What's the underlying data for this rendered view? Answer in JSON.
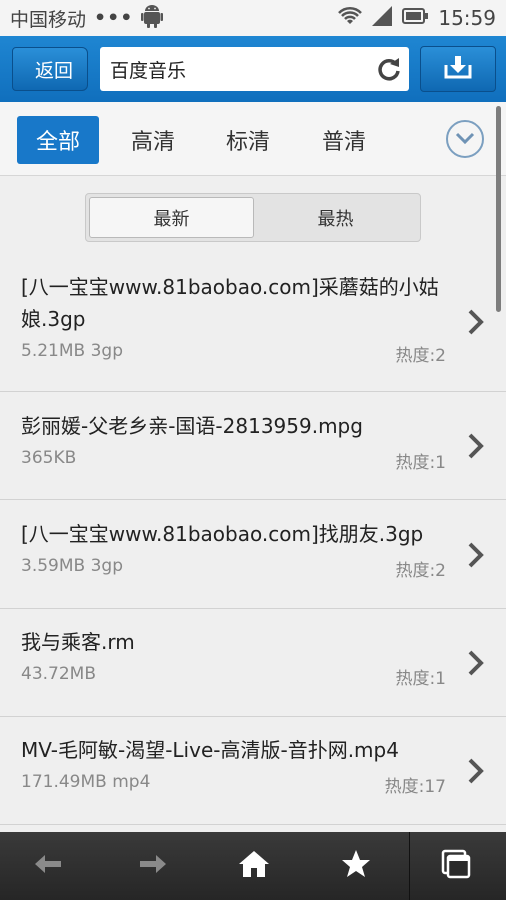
{
  "status": {
    "carrier": "中国移动",
    "dots": "•••",
    "time": "15:59"
  },
  "toolbar": {
    "back_label": "返回",
    "url": "百度音乐"
  },
  "tabs": [
    {
      "label": "全部",
      "active": true
    },
    {
      "label": "高清",
      "active": false
    },
    {
      "label": "标清",
      "active": false
    },
    {
      "label": "普清",
      "active": false
    }
  ],
  "segment": {
    "newest": "最新",
    "hottest": "最热"
  },
  "items": [
    {
      "title": "[八一宝宝www.81baobao.com]采蘑菇的小姑娘.3gp",
      "size": "5.21MB  3gp",
      "heat": "热度:2"
    },
    {
      "title": "彭丽媛-父老乡亲-国语-2813959.mpg",
      "size": "365KB",
      "heat": "热度:1"
    },
    {
      "title": "[八一宝宝www.81baobao.com]找朋友.3gp",
      "size": "3.59MB  3gp",
      "heat": "热度:2"
    },
    {
      "title": "我与乘客.rm",
      "size": "43.72MB",
      "heat": "热度:1"
    },
    {
      "title": "MV-毛阿敏-渴望-Live-高清版-音扑网.mp4",
      "size": "171.49MB  mp4",
      "heat": "热度:17"
    }
  ],
  "colors": {
    "accent": "#1878c9",
    "toolbar": "#106fbd"
  }
}
